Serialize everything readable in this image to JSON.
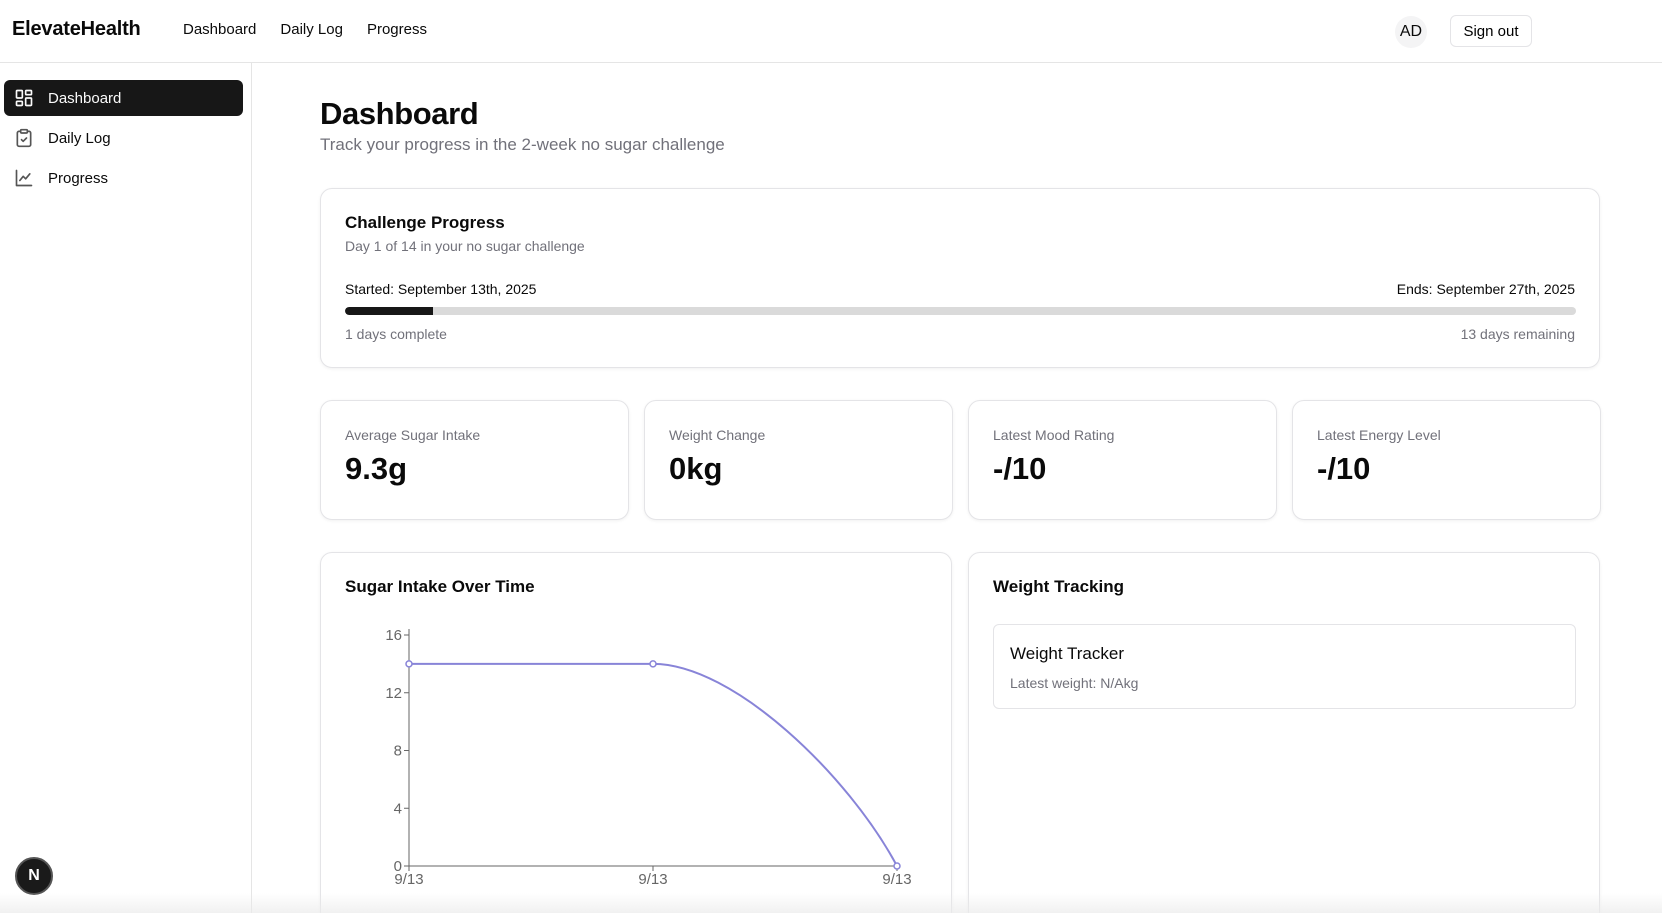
{
  "header": {
    "brand": "ElevateHealth",
    "nav": [
      "Dashboard",
      "Daily Log",
      "Progress"
    ],
    "avatar_initials": "AD",
    "signout_label": "Sign out"
  },
  "sidebar": {
    "items": [
      {
        "label": "Dashboard",
        "icon": "layout-dashboard-icon",
        "active": true
      },
      {
        "label": "Daily Log",
        "icon": "clipboard-icon",
        "active": false
      },
      {
        "label": "Progress",
        "icon": "line-chart-icon",
        "active": false
      }
    ],
    "badge": "N"
  },
  "page": {
    "title": "Dashboard",
    "subtitle": "Track your progress in the 2-week no sugar challenge"
  },
  "challenge": {
    "title": "Challenge Progress",
    "subtitle": "Day 1 of 14 in your no sugar challenge",
    "started": "Started: September 13th, 2025",
    "ends": "Ends: September 27th, 2025",
    "progress_fraction": 0.0714,
    "days_complete": "1 days complete",
    "days_remaining": "13 days remaining"
  },
  "stats": [
    {
      "label": "Average Sugar Intake",
      "value": "9.3g"
    },
    {
      "label": "Weight Change",
      "value": "0kg"
    },
    {
      "label": "Latest Mood Rating",
      "value": "-/10"
    },
    {
      "label": "Latest Energy Level",
      "value": "-/10"
    }
  ],
  "sugar_chart": {
    "title": "Sugar Intake Over Time"
  },
  "weight": {
    "title": "Weight Tracking",
    "tracker_title": "Weight Tracker",
    "tracker_sub": "Latest weight: N/Akg"
  },
  "colors": {
    "accent": "#171717",
    "line": "#8884d8",
    "muted": "#71717a"
  },
  "chart_data": {
    "type": "line",
    "title": "Sugar Intake Over Time",
    "categories": [
      "9/13",
      "9/13",
      "9/13"
    ],
    "values": [
      14,
      14,
      0
    ],
    "yticks": [
      0,
      4,
      8,
      12,
      16
    ],
    "ylim": [
      0,
      16
    ],
    "grid": false
  }
}
